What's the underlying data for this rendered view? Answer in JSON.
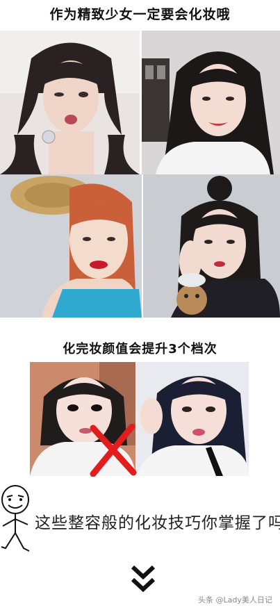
{
  "header": {
    "title": "作为精致少女一定要会化妆哦"
  },
  "section2": {
    "title": "化完妆颜值会提升3个档次"
  },
  "cta": {
    "question": "这些整容般的化妆技巧你掌握了吗"
  },
  "watermark": {
    "text": "头条 @Lady美人日记"
  },
  "photos": [
    {
      "name": "photo-girl-pigtails-wink",
      "tone": "#e9e4e2"
    },
    {
      "name": "photo-girl-long-hair-smile",
      "tone": "#d8d6d6"
    },
    {
      "name": "photo-girl-straw-hat-red-lips",
      "tone": "#cfd3d8"
    },
    {
      "name": "photo-girl-bun-with-doll",
      "tone": "#c9cdd1"
    },
    {
      "name": "photo-before-makeup",
      "tone": "#cc8a6c"
    },
    {
      "name": "photo-after-makeup",
      "tone": "#e8eaf0"
    }
  ],
  "colors": {
    "cross_mark": "#e21d1d",
    "chevron": "#111111"
  }
}
